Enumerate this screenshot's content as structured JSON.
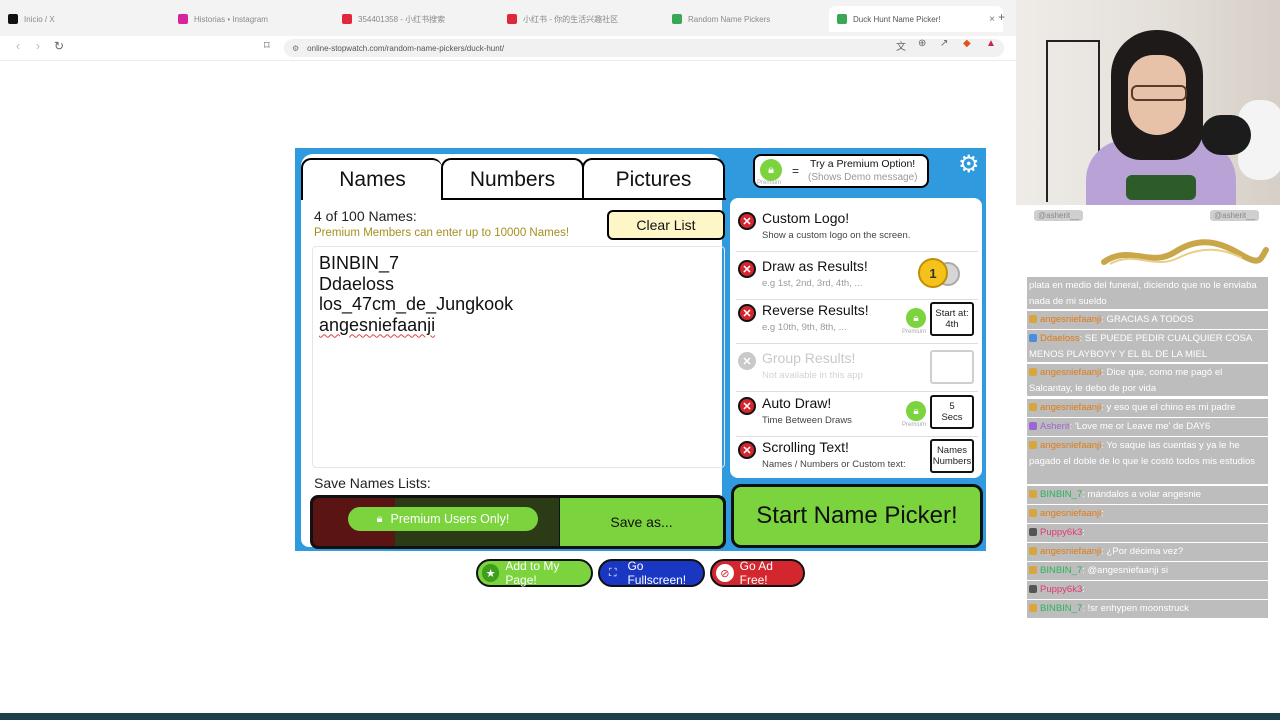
{
  "browser": {
    "tabs": [
      {
        "label": "Inicio / X",
        "color": "#111111"
      },
      {
        "label": "Historias • Instagram",
        "color": "#d6249f"
      },
      {
        "label": "354401358 - 小红书搜索",
        "color": "#e0283c"
      },
      {
        "label": "小红书 - 你的生活兴趣社区",
        "color": "#e0283c"
      },
      {
        "label": "Random Name Pickers",
        "color": "#3aa757"
      },
      {
        "label": "Duck Hunt Name Picker!",
        "color": "#3aa757"
      }
    ],
    "close_icon": "×",
    "new_tab": "+",
    "url": "online-stopwatch.com/random-name-pickers/duck-hunt/"
  },
  "widget": {
    "tabs": [
      "Names",
      "Numbers",
      "Pictures"
    ],
    "count_label": "4 of 100 Names:",
    "premium_note": "Premium Members can enter  up to 10000 Names!",
    "clear_label": "Clear List",
    "names": [
      "BINBIN_7",
      "Ddaeloss",
      "los_47cm_de_Jungkook",
      "angesniefaanji"
    ],
    "save_label": "Save Names Lists:",
    "premium_only": "Premium Users Only!",
    "save_as": "Save as...",
    "premium_bubble": {
      "title": "Try a Premium Option!",
      "subtitle": "(Shows Demo message)",
      "equals": "=",
      "lock_caption": "Premium"
    },
    "options": [
      {
        "title": "Custom Logo!",
        "subtitle": "Show a custom logo on the screen."
      },
      {
        "title": "Draw as Results!",
        "subtitle": "e.g 1st, 2nd, 3rd, 4th, ...",
        "medal": "1"
      },
      {
        "title": "Reverse Results!",
        "subtitle": "e.g 10th, 9th, 8th, ...",
        "box_line1": "Start at:",
        "box_line2": "4th",
        "lock_caption": "Premium"
      },
      {
        "title": "Group Results!",
        "subtitle": "Not available in this app"
      },
      {
        "title": "Auto Draw!",
        "subtitle": "Time Between Draws",
        "box_line1": "5",
        "box_line2": "Secs",
        "lock_caption": "Premium"
      },
      {
        "title": "Scrolling Text!",
        "subtitle": "Names / Numbers or Custom text:",
        "box_line1": "Names",
        "box_line2": "Numbers"
      }
    ],
    "start_label": "Start Name Picker!"
  },
  "bottom_buttons": [
    {
      "label": "Add to My Page!",
      "color": "#7bd43d"
    },
    {
      "label": "Go Fullscreen!",
      "color": "#1a37c4"
    },
    {
      "label": "Go Ad Free!",
      "color": "#d4262f"
    }
  ],
  "stream": {
    "name_tags": [
      "@asherit__",
      "@asherit__"
    ],
    "chat": [
      {
        "user": "",
        "text": "plata en medio del funeral, diciendo que no le enviaba nada de mi sueldo"
      },
      {
        "user": "angesniefaanji",
        "text": ": GRACIAS A TODOS"
      },
      {
        "user": "Ddaeloss",
        "text": ": SE PUEDE PEDIR CUALQUIER COSA MENOS PLAYBOYY Y EL BL DE LA MIEL"
      },
      {
        "user": "angesniefaanji",
        "text": ": Dice que, como me pagó el Salcantay, le debo de por vida"
      },
      {
        "user": "angesniefaanji",
        "text": ": y eso que el chino es mi padre"
      },
      {
        "user": "Asherit",
        "text": ": 'Love me or Leave me' de DAY6"
      },
      {
        "user": "angesniefaanji",
        "text": ": Yo saque las cuentas y ya le he pagado el doble de lo que le costó todos mis estudios"
      },
      {
        "user": "BINBIN_7",
        "text": ": mándalos a volar angesnie"
      },
      {
        "user": "angesniefaanji",
        "text": ":"
      },
      {
        "user": "Puppy6k3",
        "text": ":"
      },
      {
        "user": "angesniefaanji",
        "text": ": ¿Por décima vez?"
      },
      {
        "user": "BINBIN_7",
        "text": ": @angesniefaanji si"
      },
      {
        "user": "Puppy6k3",
        "text": ":"
      },
      {
        "user": "BINBIN_7",
        "text": ": !sr enhypen moonstruck"
      }
    ]
  }
}
